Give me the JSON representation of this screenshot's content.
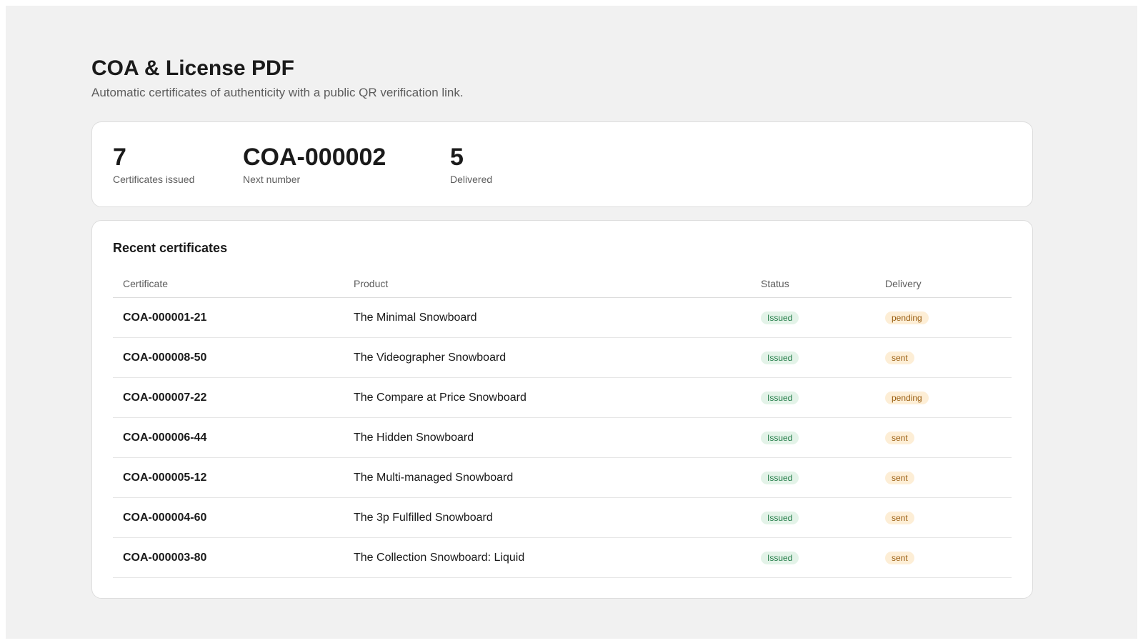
{
  "header": {
    "title": "COA & License PDF",
    "subtitle": "Automatic certificates of authenticity with a public QR verification link."
  },
  "stats": [
    {
      "value": "7",
      "label": "Certificates issued"
    },
    {
      "value": "COA-000002",
      "label": "Next number"
    },
    {
      "value": "5",
      "label": "Delivered"
    }
  ],
  "recent": {
    "title": "Recent certificates",
    "columns": {
      "certificate": "Certificate",
      "product": "Product",
      "status": "Status",
      "delivery": "Delivery"
    },
    "rows": [
      {
        "certificate": "COA-000001-21",
        "product": "The Minimal Snowboard",
        "status": "Issued",
        "delivery": "pending"
      },
      {
        "certificate": "COA-000008-50",
        "product": "The Videographer Snowboard",
        "status": "Issued",
        "delivery": "sent"
      },
      {
        "certificate": "COA-000007-22",
        "product": "The Compare at Price Snowboard",
        "status": "Issued",
        "delivery": "pending"
      },
      {
        "certificate": "COA-000006-44",
        "product": "The Hidden Snowboard",
        "status": "Issued",
        "delivery": "sent"
      },
      {
        "certificate": "COA-000005-12",
        "product": "The Multi-managed Snowboard",
        "status": "Issued",
        "delivery": "sent"
      },
      {
        "certificate": "COA-000004-60",
        "product": "The 3p Fulfilled Snowboard",
        "status": "Issued",
        "delivery": "sent"
      },
      {
        "certificate": "COA-000003-80",
        "product": "The Collection Snowboard: Liquid",
        "status": "Issued",
        "delivery": "sent"
      }
    ]
  },
  "colors": {
    "page_bg": "#f1f1f1",
    "card_bg": "#ffffff",
    "issued_badge_bg": "#e3f3e8",
    "issued_badge_text": "#1f7a45",
    "delivery_badge_bg": "#fdeed6",
    "delivery_badge_text": "#9a5e10"
  }
}
